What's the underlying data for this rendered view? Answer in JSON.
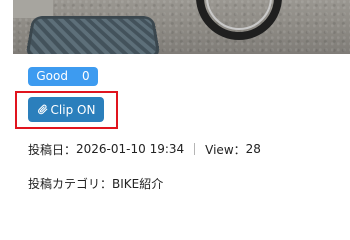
{
  "article": {
    "good": {
      "label": "Good",
      "count": "0"
    },
    "clip": {
      "label": "Clip ON",
      "icon": "paperclip-icon"
    },
    "meta": {
      "posted_label": "投稿日：",
      "posted_value": "2026-01-10 19:34",
      "view_label": "View：",
      "view_value": "28"
    },
    "category": {
      "label": "投稿カテゴリ：",
      "value": "BIKE紹介"
    }
  },
  "colors": {
    "good_badge": "#3d9bf0",
    "clip_button": "#2b7fbc",
    "focus_outline": "#e0141e"
  }
}
